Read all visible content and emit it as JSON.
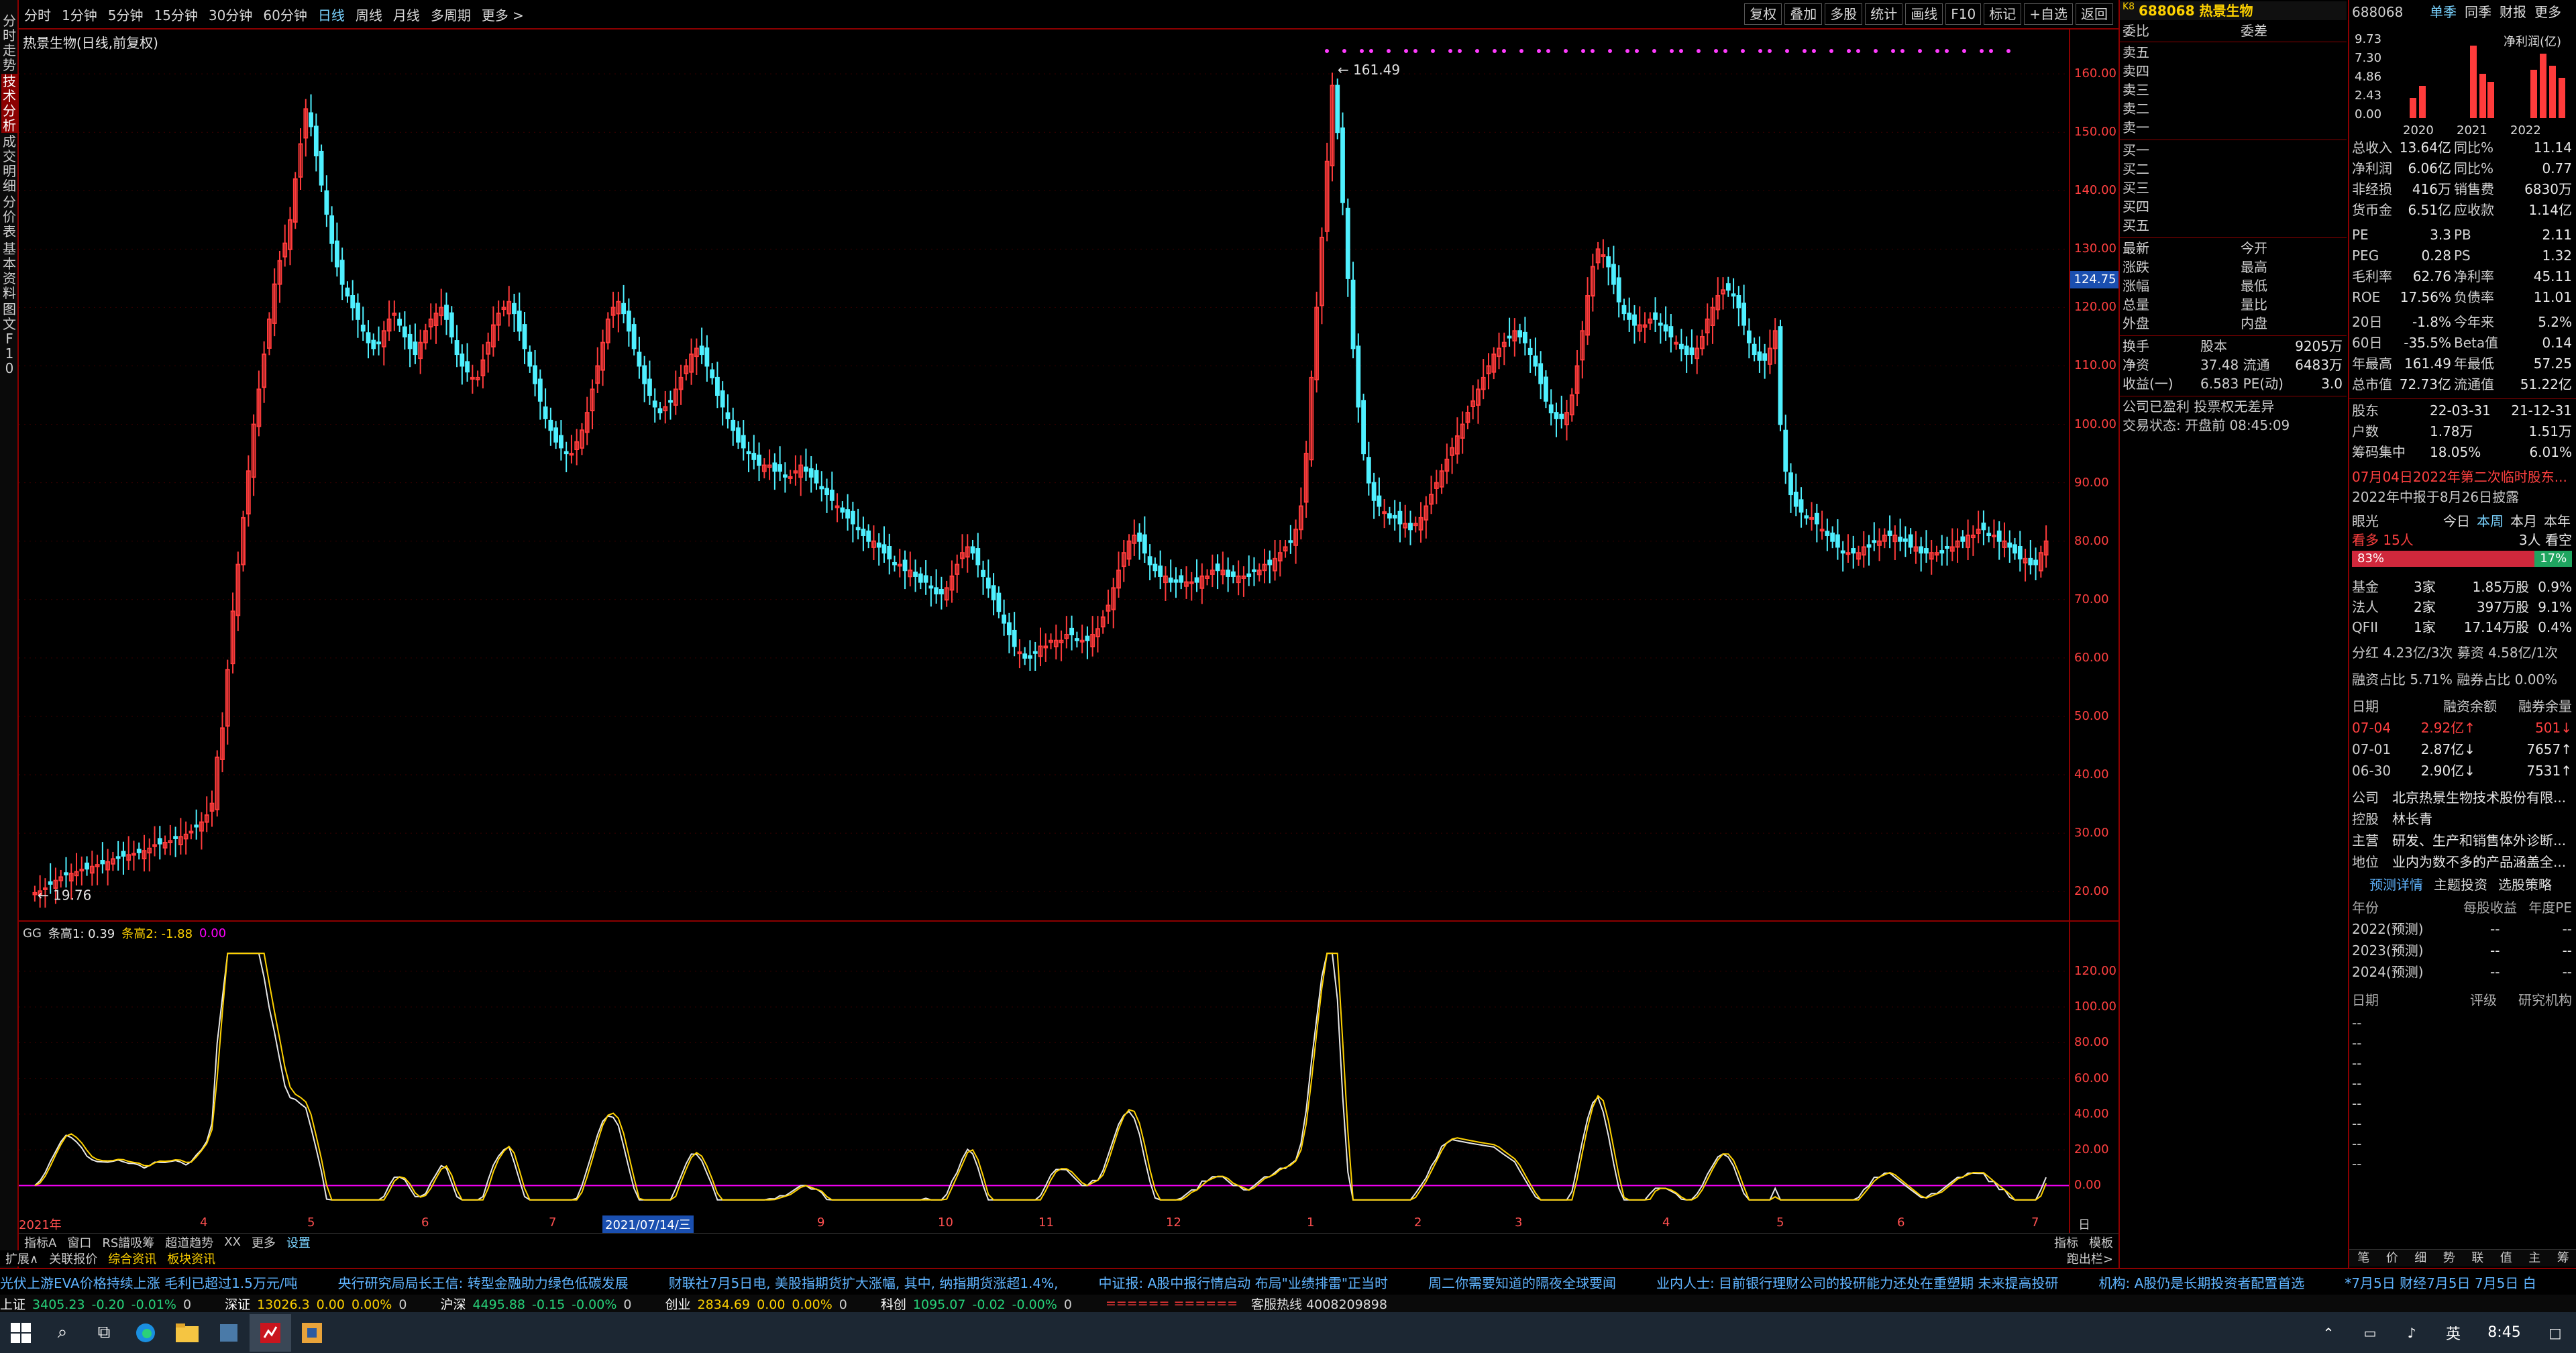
{
  "sidebar": {
    "items": [
      "分时走势",
      "技术分析",
      "成交明细",
      "分价表",
      "基本资料",
      "图文F10"
    ],
    "active_index": 1
  },
  "topbar": {
    "periods": [
      "分时",
      "1分钟",
      "5分钟",
      "15分钟",
      "30分钟",
      "60分钟",
      "日线",
      "周线",
      "月线",
      "多周期",
      "更多 >"
    ],
    "active_period": "日线",
    "tools": [
      "复权",
      "叠加",
      "多股",
      "统计",
      "画线",
      "F10",
      "标记",
      "+自选",
      "返回"
    ]
  },
  "stock": {
    "title": "热景生物(日线,前复权)",
    "code_prefix": "K8",
    "code": "688068",
    "name": "热景生物"
  },
  "price_axis": {
    "ticks": [
      "160.00",
      "150.00",
      "140.00",
      "130.00",
      "120.00",
      "110.00",
      "100.00",
      "90.00",
      "80.00",
      "70.00",
      "60.00",
      "50.00",
      "40.00",
      "30.00",
      "20.00"
    ],
    "current_label": "124.75"
  },
  "chart_annotations": {
    "high_label": "161.49",
    "low_label": "19.76"
  },
  "indicator": {
    "name": "GG",
    "line1_label": "条高1: 0.39",
    "line2_label": "条高2: -1.88",
    "line3_label": "0.00",
    "axis_ticks": [
      "120.00",
      "100.00",
      "80.00",
      "60.00",
      "40.00",
      "20.00",
      "0.00"
    ],
    "colors": {
      "line1": "#e8e8e8",
      "line2": "#ffd200",
      "zero": "#ff00ff"
    }
  },
  "date_axis": {
    "labels": [
      "2021年",
      "4",
      "5",
      "6",
      "7",
      "2021/07/14/三",
      "9",
      "10",
      "11",
      "12",
      "1",
      "2",
      "3",
      "4",
      "5",
      "6",
      "7"
    ],
    "right_label": "日线"
  },
  "bottom_tabs": {
    "items": [
      "指标A",
      "窗口",
      "RS譜吸筹",
      "超道趋势",
      "XX",
      "更多",
      "设置"
    ],
    "active": "设置",
    "right_items": [
      "指标",
      "模板"
    ]
  },
  "extra_tabs": {
    "items": [
      "扩展∧",
      "关联报价",
      "综合资讯",
      "板块资讯"
    ],
    "right": "跑出栏>"
  },
  "order_book": {
    "header_left": "委比",
    "header_right": "委差",
    "asks": [
      "卖五",
      "卖四",
      "卖三",
      "卖二",
      "卖一"
    ],
    "bids": [
      "买一",
      "买二",
      "买三",
      "买四",
      "买五"
    ]
  },
  "quote": {
    "rows": [
      {
        "l": "最新",
        "m": "今开",
        "v": ""
      },
      {
        "l": "涨跌",
        "m": "最高",
        "v": ""
      },
      {
        "l": "涨幅",
        "m": "最低",
        "v": ""
      },
      {
        "l": "总量",
        "m": "量比",
        "v": ""
      },
      {
        "l": "外盘",
        "m": "内盘",
        "v": ""
      }
    ],
    "rows2": [
      {
        "l": "换手",
        "m": "股本",
        "v": "9205万"
      },
      {
        "l": "净资",
        "m": "37.48  流通",
        "v": "6483万"
      },
      {
        "l": "收益(一)",
        "m": "6.583  PE(动)",
        "v": "3.0"
      }
    ],
    "notice1": "公司已盈利 投票权无差异",
    "notice2": "交易状态: 开盘前 08:45:09"
  },
  "finance": {
    "code": "688068",
    "tabs": [
      "单季",
      "同季",
      "财报",
      "更多"
    ],
    "chart_title": "净利润(亿)",
    "chart_ticks": [
      "9.73",
      "7.30",
      "4.86",
      "2.43",
      "0.00"
    ],
    "chart_years": [
      "2020",
      "2021",
      "2022"
    ],
    "rows": [
      {
        "l": "总收入",
        "v": "13.64亿",
        "l2": "同比%",
        "v2": "11.14"
      },
      {
        "l": "净利润",
        "v": "6.06亿",
        "l2": "同比%",
        "v2": "0.77"
      },
      {
        "l": "非经损",
        "v": "416万",
        "l2": "销售费",
        "v2": "6830万"
      },
      {
        "l": "货币金",
        "v": "6.51亿",
        "l2": "应收款",
        "v2": "1.14亿"
      },
      {
        "l": "PE",
        "v": "3.3",
        "l2": "PB",
        "v2": "2.11"
      },
      {
        "l": "PEG",
        "v": "0.28",
        "l2": "PS",
        "v2": "1.32"
      },
      {
        "l": "毛利率",
        "v": "62.76",
        "l2": "净利率",
        "v2": "45.11"
      },
      {
        "l": "ROE",
        "v": "17.56%",
        "l2": "负债率",
        "v2": "11.01"
      },
      {
        "l": "20日",
        "v": "-1.8%",
        "l2": "今年来",
        "v2": "5.2%"
      },
      {
        "l": "60日",
        "v": "-35.5%",
        "l2": "Beta值",
        "v2": "0.14"
      },
      {
        "l": "年最高",
        "v": "161.49",
        "l2": "年最低",
        "v2": "57.25"
      },
      {
        "l": "总市值",
        "v": "72.73亿",
        "l2": "流通值",
        "v2": "51.22亿"
      }
    ],
    "holders": [
      {
        "l": "股东",
        "v": "22-03-31",
        "v2": "21-12-31"
      },
      {
        "l": "户数",
        "v": "1.78万",
        "v2": "1.51万"
      },
      {
        "l": "筹码集中",
        "v": "18.05%",
        "v2": "6.01%"
      }
    ],
    "news1": "07月04日2022年第二次临时股东...",
    "news2": "2022年中报于8月26日披露",
    "sentiment": {
      "label": "眼光",
      "tabs": [
        "今日",
        "本周",
        "本月",
        "本年"
      ],
      "active": "本周",
      "bull": "看多 15人",
      "bear": "3人 看空",
      "bull_pct": "83%",
      "bear_pct": "17%",
      "bull_ratio": 0.83
    },
    "institutions": [
      {
        "l": "基金",
        "a": "3家",
        "b": "1.85万股",
        "c": "0.9%"
      },
      {
        "l": "法人",
        "a": "2家",
        "b": "397万股",
        "c": "9.1%"
      },
      {
        "l": "QFII",
        "a": "1家",
        "b": "17.14万股",
        "c": "0.4%"
      }
    ],
    "dividend": "分红  4.23亿/3次  募资  4.58亿/1次",
    "margin_ratio": "融资占比  5.71%  融券占比  0.00%",
    "margin_header": [
      "日期",
      "融资余额",
      "融券余量"
    ],
    "margin_rows": [
      {
        "d": "07-04",
        "a": "2.92亿↑",
        "b": "501↓"
      },
      {
        "d": "07-01",
        "a": "2.87亿↓",
        "b": "7657↑"
      },
      {
        "d": "06-30",
        "a": "2.90亿↓",
        "b": "7531↑"
      }
    ],
    "company": [
      {
        "l": "公司",
        "v": "北京热景生物技术股份有限..."
      },
      {
        "l": "控股",
        "v": "林长青"
      },
      {
        "l": "主营",
        "v": "研发、生产和销售体外诊断..."
      },
      {
        "l": "地位",
        "v": "业内为数不多的产品涵盖全..."
      }
    ],
    "forecast_tabs": [
      "预测详情",
      "主题投资",
      "选股策略"
    ],
    "forecast_header": [
      "年份",
      "每股收益",
      "年度PE"
    ],
    "forecast_rows": [
      {
        "y": "2022(预测)",
        "a": "--",
        "b": "--"
      },
      {
        "y": "2023(预测)",
        "a": "--",
        "b": "--"
      },
      {
        "y": "2024(预测)",
        "a": "--",
        "b": "--"
      }
    ],
    "research_header": [
      "日期",
      "评级",
      "研究机构"
    ],
    "bottom_tabs": [
      "笔",
      "价",
      "细",
      "势",
      "联",
      "值",
      "主",
      "筹"
    ]
  },
  "ticker": [
    "光伏上游EVA价格持续上涨  毛利已超过1.5万元/吨",
    "央行研究局局长王信: 转型金融助力绿色低碳发展",
    "财联社7月5日电, 美股指期货扩大涨幅, 其中, 纳指期货涨超1.4%,",
    "中证报: A股中报行情启动 布局\"业绩排雷\"正当时",
    "周二你需要知道的隔夜全球要闻",
    "业内人士: 目前银行理财公司的投研能力还处在重塑期 未来提高投研",
    "机构: A股仍是长期投资者配置首选",
    "*7月5日 财经7月5日 7月5日 白"
  ],
  "indices": [
    {
      "name": "上证",
      "val": "3405.23",
      "chg": "-0.20",
      "pct": "-0.01%",
      "amt": "0"
    },
    {
      "name": "深证",
      "val": "13026.3",
      "chg": "0.00",
      "pct": "0.00%",
      "amt": "0"
    },
    {
      "name": "沪深",
      "val": "4495.88",
      "chg": "-0.15",
      "pct": "-0.00%",
      "amt": "0"
    },
    {
      "name": "创业",
      "val": "2834.69",
      "chg": "0.00",
      "pct": "0.00%",
      "amt": "0"
    },
    {
      "name": "科创",
      "val": "1095.07",
      "chg": "-0.02",
      "pct": "-0.00%",
      "amt": "0"
    }
  ],
  "hotline": "客服热线 4008209898",
  "taskbar": {
    "time": "8:45",
    "lang": "英"
  },
  "chart_data": {
    "type": "candlestick",
    "ylim": [
      16,
      163
    ],
    "up_color": "#ff3b3b",
    "down_color": "#4ff0ff",
    "closes": [
      19.8,
      20.1,
      20.6,
      21.3,
      21.9,
      22.5,
      22.9,
      23.1,
      23.4,
      23.8,
      23.9,
      24.3,
      24.6,
      24.8,
      25.1,
      25.6,
      25.8,
      26.1,
      26.3,
      26.5,
      26.7,
      27.0,
      27.4,
      28.0,
      28.2,
      28.4,
      28.7,
      29.1,
      29.4,
      29.8,
      30.3,
      31.1,
      31.9,
      33.1,
      35.1,
      43.0,
      48.0,
      58.0,
      68.0,
      76.0,
      84.0,
      92.0,
      100.0,
      106.0,
      112.0,
      118.0,
      124.0,
      128.0,
      131.0,
      135.0,
      142.0,
      148.0,
      154.0,
      151.0,
      146.0,
      141.0,
      136.0,
      131.0,
      127.0,
      124.0,
      122.0,
      120.0,
      118.0,
      116.0,
      114.0,
      113.0,
      114.0,
      116.0,
      118.0,
      119.0,
      117.0,
      115.0,
      113.0,
      112.0,
      114.0,
      116.0,
      118.0,
      119.0,
      120.0,
      118.0,
      115.0,
      112.0,
      110.0,
      109.0,
      108.0,
      108.0,
      111.0,
      114.0,
      117.0,
      119.0,
      120.0,
      121.0,
      119.0,
      116.0,
      113.0,
      110.0,
      107.0,
      104.0,
      101.0,
      99.0,
      97.0,
      96.0,
      95.0,
      95.0,
      97.0,
      99.0,
      102.0,
      106.0,
      110.0,
      114.0,
      118.0,
      120.0,
      121.0,
      119.0,
      116.0,
      113.0,
      110.0,
      107.0,
      105.0,
      103.0,
      102.0,
      103.0,
      104.0,
      106.0,
      108.0,
      110.0,
      112.0,
      113.0,
      112.0,
      110.0,
      108.0,
      105.0,
      103.0,
      101.0,
      99.0,
      97.0,
      96.0,
      95.0,
      94.0,
      93.0,
      93.0,
      93.0,
      92.0,
      92.0,
      91.0,
      91.0,
      92.0,
      93.0,
      92.0,
      91.0,
      90.0,
      89.0,
      88.0,
      87.0,
      86.0,
      85.0,
      84.0,
      83.0,
      82.0,
      81.0,
      80.0,
      80.0,
      79.0,
      78.0,
      77.0,
      76.0,
      76.0,
      75.0,
      75.0,
      74.0,
      73.0,
      73.0,
      72.0,
      71.0,
      71.0,
      72.0,
      74.0,
      76.0,
      78.0,
      79.0,
      78.0,
      76.0,
      74.0,
      72.0,
      70.0,
      68.0,
      66.0,
      64.0,
      62.0,
      61.0,
      60.0,
      60.0,
      61.0,
      62.0,
      62.0,
      63.0,
      63.0,
      63.0,
      64.0,
      64.0,
      63.0,
      63.0,
      63.0,
      64.0,
      65.0,
      67.0,
      69.0,
      72.0,
      75.0,
      78.0,
      80.0,
      81.0,
      80.0,
      78.0,
      76.0,
      75.0,
      74.0,
      74.0,
      73.0,
      73.0,
      73.0,
      73.0,
      73.0,
      73.0,
      74.0,
      74.0,
      75.0,
      75.0,
      75.0,
      74.0,
      74.0,
      74.0,
      74.0,
      74.0,
      75.0,
      75.0,
      76.0,
      76.0,
      77.0,
      78.0,
      79.0,
      80.0,
      82.0,
      86.0,
      95.0,
      108.0,
      120.0,
      132.0,
      145.0,
      158.0,
      150.0,
      138.0,
      125.0,
      113.0,
      103.0,
      95.0,
      90.0,
      87.0,
      86.0,
      85.0,
      84.0,
      84.0,
      83.0,
      83.0,
      82.0,
      83.0,
      84.0,
      86.0,
      88.0,
      90.0,
      92.0,
      94.0,
      96.0,
      98.0,
      100.0,
      102.0,
      104.0,
      106.0,
      108.0,
      110.0,
      112.0,
      113.0,
      114.0,
      115.0,
      116.0,
      115.0,
      114.0,
      112.0,
      110.0,
      107.0,
      104.0,
      102.0,
      101.0,
      101.0,
      102.0,
      105.0,
      110.0,
      116.0,
      122.0,
      127.0,
      130.0,
      129.0,
      127.0,
      124.0,
      121.0,
      119.0,
      118.0,
      117.0,
      117.0,
      117.0,
      118.0,
      118.0,
      117.0,
      116.0,
      115.0,
      114.0,
      113.0,
      112.0,
      112.0,
      113.0,
      115.0,
      118.0,
      120.0,
      122.0,
      123.0,
      123.0,
      122.0,
      120.0,
      117.0,
      114.0,
      112.0,
      111.0,
      111.0,
      113.0,
      116.0,
      100.0,
      92.0,
      88.0,
      86.0,
      85.0,
      84.0,
      84.0,
      83.0,
      82.0,
      81.0,
      80.0,
      79.0,
      78.0,
      78.0,
      78.0,
      78.0,
      79.0,
      79.0,
      80.0,
      80.0,
      81.0,
      81.0,
      81.0,
      80.0,
      80.0,
      79.0,
      79.0,
      78.0,
      78.0,
      78.0,
      78.0,
      78.0,
      79.0,
      79.0,
      80.0,
      80.0,
      81.0,
      81.0,
      82.0,
      82.0,
      81.0,
      81.0,
      80.0,
      80.0,
      79.0,
      78.0,
      77.0,
      77.0,
      76.0,
      76.0,
      78.0,
      80.0
    ]
  }
}
